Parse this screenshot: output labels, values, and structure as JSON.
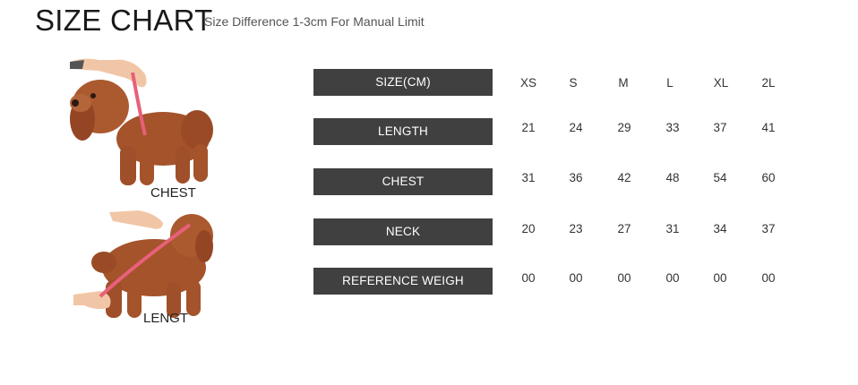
{
  "header": {
    "title": "SIZE CHART",
    "subtitle": "Size Difference 1-3cm For Manual Limit"
  },
  "photos": [
    {
      "label": "CHEST"
    },
    {
      "label": "LENGT"
    }
  ],
  "table": {
    "header_label": "SIZE(CM)",
    "sizes": [
      "XS",
      "S",
      "M",
      "L",
      "XL",
      "2L"
    ],
    "rows": [
      {
        "label": "LENGTH",
        "values": [
          "21",
          "24",
          "29",
          "33",
          "37",
          "41"
        ]
      },
      {
        "label": "CHEST",
        "values": [
          "31",
          "36",
          "42",
          "48",
          "54",
          "60"
        ]
      },
      {
        "label": "NECK",
        "values": [
          "20",
          "23",
          "27",
          "31",
          "34",
          "37"
        ]
      },
      {
        "label": "REFERENCE WEIGH",
        "values": [
          "00",
          "00",
          "00",
          "00",
          "00",
          "00"
        ]
      }
    ]
  },
  "colors": {
    "label_bg": "#404040",
    "dog_fur": "#a4532b",
    "tape": "#e8607a"
  }
}
